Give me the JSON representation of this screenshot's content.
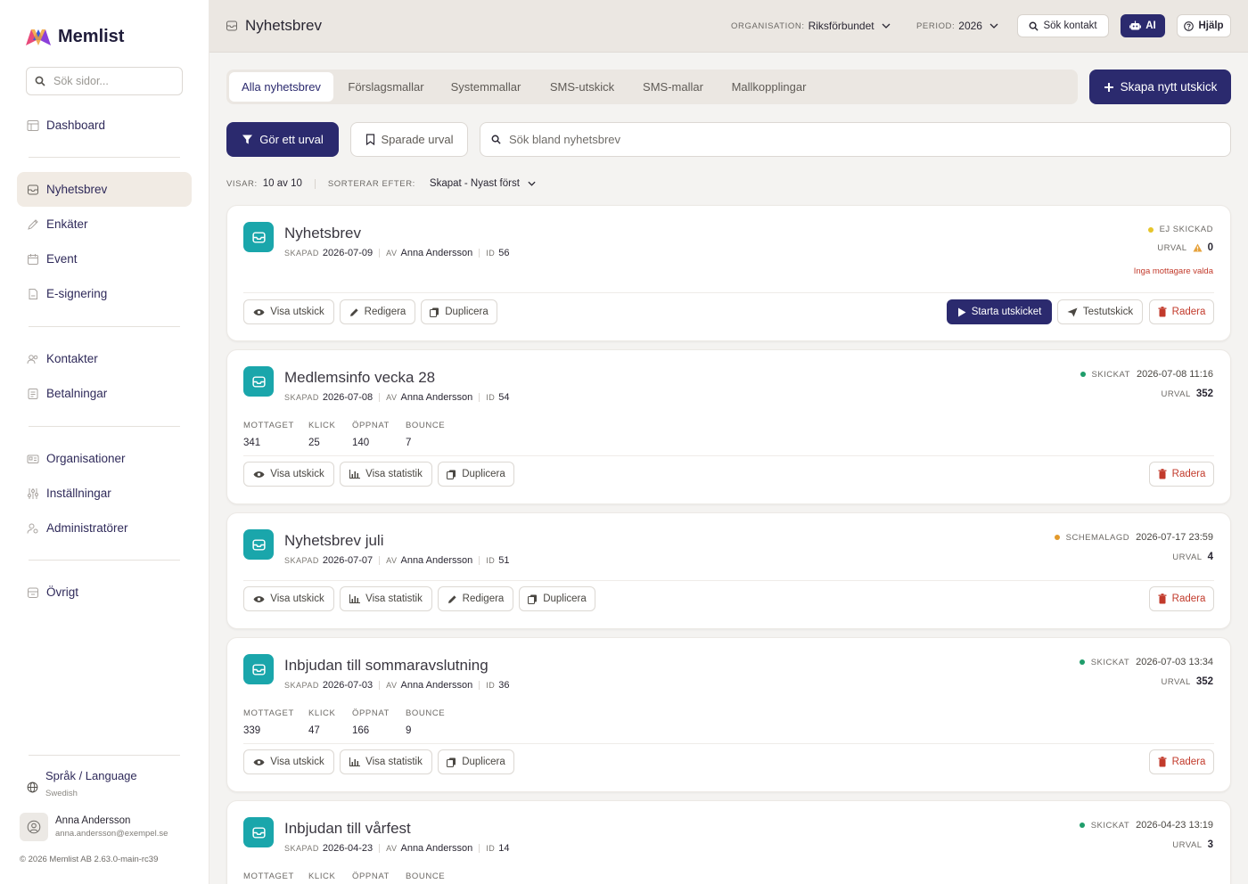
{
  "sidebar": {
    "brand": "Memlist",
    "search_placeholder": "Sök sidor...",
    "items": [
      {
        "label": "Dashboard",
        "icon": "dashboard-icon"
      },
      {
        "label": "Nyhetsbrev",
        "icon": "newsletter-icon",
        "active": true
      },
      {
        "label": "Enkäter",
        "icon": "survey-icon"
      },
      {
        "label": "Event",
        "icon": "event-icon"
      },
      {
        "label": "E-signering",
        "icon": "esign-icon"
      },
      {
        "label": "Kontakter",
        "icon": "contacts-icon"
      },
      {
        "label": "Betalningar",
        "icon": "payments-icon"
      },
      {
        "label": "Organisationer",
        "icon": "organisations-icon"
      },
      {
        "label": "Inställningar",
        "icon": "settings-icon"
      },
      {
        "label": "Administratörer",
        "icon": "admins-icon"
      },
      {
        "label": "Övrigt",
        "icon": "other-icon"
      }
    ],
    "language": {
      "label": "Språk / Language",
      "value": "Swedish"
    },
    "user": {
      "name": "Anna Andersson",
      "email": "anna.andersson@exempel.se"
    },
    "copyright": "© 2026  Memlist AB 2.63.0-main-rc39"
  },
  "topbar": {
    "title": "Nyhetsbrev",
    "org_label": "ORGANISATION:",
    "org_value": "Riksförbundet",
    "period_label": "PERIOD:",
    "period_value": "2026",
    "search_contact": "Sök kontakt",
    "ai": "AI",
    "help": "Hjälp"
  },
  "tabs": [
    "Alla nyhetsbrev",
    "Förslagsmallar",
    "Systemmallar",
    "SMS-utskick",
    "SMS-mallar",
    "Mallkopplingar"
  ],
  "create_button": "Skapa nytt utskick",
  "filter": {
    "make_selection": "Gör ett urval",
    "saved": "Sparade urval",
    "search_placeholder": "Sök bland nyhetsbrev"
  },
  "listing": {
    "showing_label": "VISAR:",
    "showing_value": "10 av 10",
    "sort_label": "SORTERAR EFTER:",
    "sort_value": "Skapat - Nyast först"
  },
  "labels": {
    "created": "SKAPAD",
    "by": "AV",
    "id": "ID",
    "urval": "URVAL",
    "received": "MOTTAGET",
    "clicks": "KLICK",
    "opened": "ÖPPNAT",
    "bounce": "BOUNCE"
  },
  "colors": {
    "primary": "#2b2a6e",
    "teal": "#1aa6ab",
    "danger": "#c23a2b",
    "sent": "#1f9d6b",
    "scheduled": "#e39a2c",
    "not_sent": "#e6c52a"
  },
  "cards": [
    {
      "title": "Nyhetsbrev",
      "created": "2026-07-09",
      "author": "Anna Andersson",
      "id": "56",
      "status": "EJ SKICKAD",
      "status_date": "",
      "urval": "0",
      "warning": "Inga mottagare valda",
      "actions": [
        "Visa utskick",
        "Redigera",
        "Duplicera"
      ],
      "right_actions": [
        "Starta utskicket",
        "Testutskick",
        "Radera"
      ]
    },
    {
      "title": "Medlemsinfo vecka 28",
      "created": "2026-07-08",
      "author": "Anna Andersson",
      "id": "54",
      "status": "SKICKAT",
      "status_date": "2026-07-08 11:16",
      "urval": "352",
      "stats": {
        "received": "341",
        "clicks": "25",
        "opened": "140",
        "bounce": "7"
      },
      "actions": [
        "Visa utskick",
        "Visa statistik",
        "Duplicera"
      ],
      "right_actions": [
        "Radera"
      ]
    },
    {
      "title": "Nyhetsbrev juli",
      "created": "2026-07-07",
      "author": "Anna Andersson",
      "id": "51",
      "status": "SCHEMALAGD",
      "status_date": "2026-07-17 23:59",
      "urval": "4",
      "actions": [
        "Visa utskick",
        "Visa statistik",
        "Redigera",
        "Duplicera"
      ],
      "right_actions": [
        "Radera"
      ]
    },
    {
      "title": "Inbjudan till sommaravslutning",
      "created": "2026-07-03",
      "author": "Anna Andersson",
      "id": "36",
      "status": "SKICKAT",
      "status_date": "2026-07-03 13:34",
      "urval": "352",
      "stats": {
        "received": "339",
        "clicks": "47",
        "opened": "166",
        "bounce": "9"
      },
      "actions": [
        "Visa utskick",
        "Visa statistik",
        "Duplicera"
      ],
      "right_actions": [
        "Radera"
      ]
    },
    {
      "title": "Inbjudan till vårfest",
      "created": "2026-04-23",
      "author": "Anna Andersson",
      "id": "14",
      "status": "SKICKAT",
      "status_date": "2026-04-23 13:19",
      "urval": "3"
    }
  ]
}
